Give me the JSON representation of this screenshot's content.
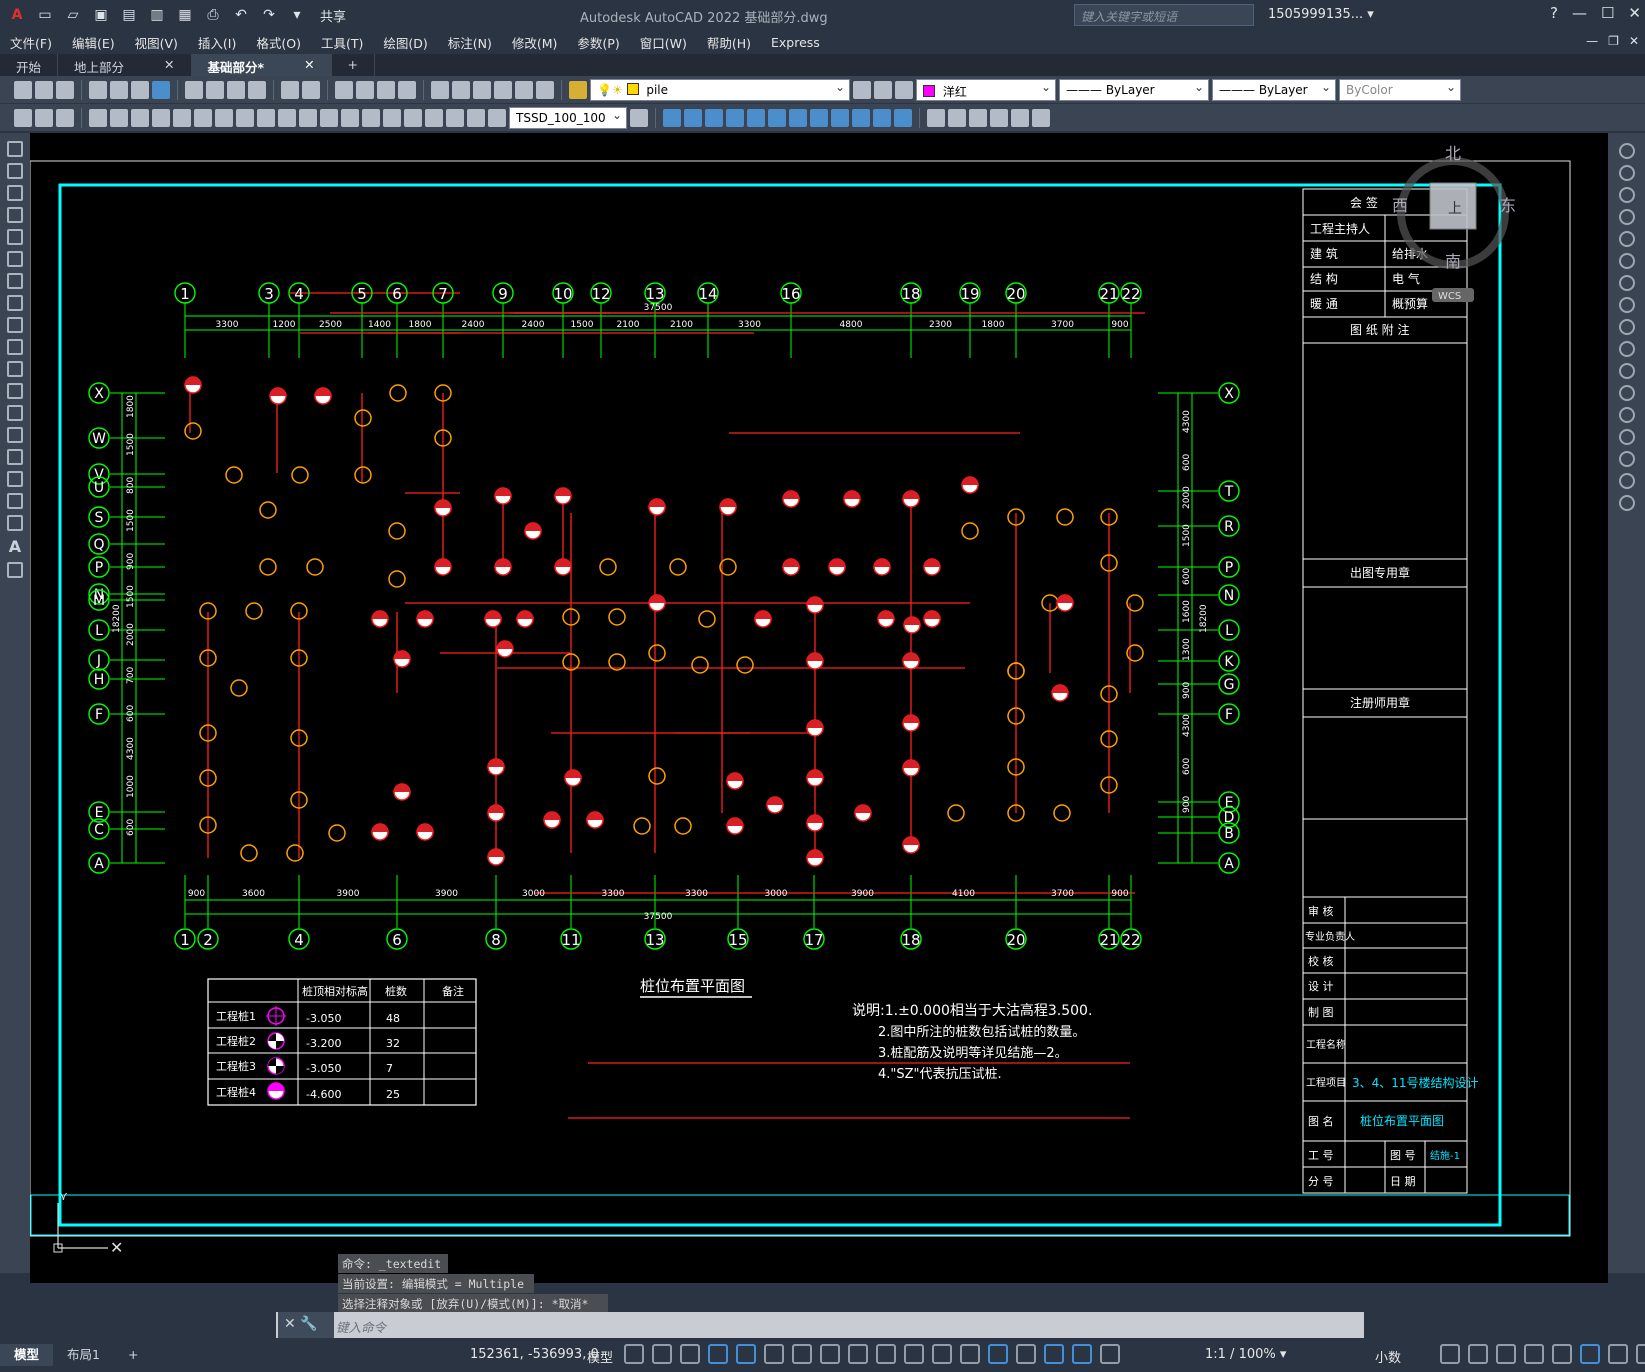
{
  "app": {
    "title": "Autodesk AutoCAD 2022    基础部分.dwg",
    "share_label": "共享",
    "search_placeholder": "键入关键字或短语",
    "user": "1505999135... ▾"
  },
  "menu": [
    "文件(F)",
    "编辑(E)",
    "视图(V)",
    "插入(I)",
    "格式(O)",
    "工具(T)",
    "绘图(D)",
    "标注(N)",
    "修改(M)",
    "参数(P)",
    "窗口(W)",
    "帮助(H)",
    "Express"
  ],
  "tabs": [
    {
      "label": "开始",
      "active": false
    },
    {
      "label": "地上部分",
      "active": false
    },
    {
      "label": "基础部分*",
      "active": true
    }
  ],
  "toolbar": {
    "layer": "pile",
    "color": "洋红",
    "color_hex": "#ff00ff",
    "linetype": "ByLayer",
    "lineweight": "ByLayer",
    "plotstyle": "ByColor",
    "dimstyle": "TSSD_100_100"
  },
  "viewcube": {
    "north": "北",
    "south": "南",
    "east": "东",
    "west": "西",
    "face": "上",
    "wcs": "WCS"
  },
  "drawing": {
    "top_axes": [
      "1",
      "3",
      "4",
      "5",
      "6",
      "7",
      "9",
      "10",
      "12",
      "13",
      "14",
      "16",
      "18",
      "19",
      "20",
      "21",
      "22"
    ],
    "bottom_axes": [
      "1",
      "2",
      "4",
      "6",
      "8",
      "11",
      "13",
      "15",
      "17",
      "18",
      "20",
      "21",
      "22"
    ],
    "left_axes": [
      "X",
      "W",
      "V",
      "U",
      "S",
      "Q",
      "P",
      "N",
      "M",
      "L",
      "J",
      "H",
      "F",
      "E",
      "C",
      "A"
    ],
    "right_axes": [
      "X",
      "T",
      "R",
      "P",
      "N",
      "L",
      "K",
      "G",
      "F",
      "E",
      "D",
      "B",
      "A"
    ],
    "top_dims": [
      "3300",
      "1200",
      "2500",
      "1400",
      "1800",
      "2400",
      "2400",
      "1500",
      "2100",
      "2100",
      "3300",
      "4800",
      "2300",
      "1800",
      "3700",
      "900"
    ],
    "bottom_dims": [
      "900",
      "3600",
      "3900",
      "3900",
      "3000",
      "3300",
      "3300",
      "3000",
      "3900",
      "4100",
      "3700",
      "900"
    ],
    "total_dim": "37500",
    "left_dims": [
      "1800",
      "1500",
      "800",
      "1500",
      "900",
      "1500",
      "2000",
      "700",
      "600",
      "4300",
      "1000",
      "600"
    ],
    "left_total": "18200",
    "right_dims": [
      "4300",
      "600",
      "2000",
      "1500",
      "600",
      "1600",
      "1300",
      "900",
      "4300",
      "600",
      "900"
    ],
    "right_total": "18200",
    "plan_title": "桩位布置平面图",
    "notes": [
      "说明:1.±0.000相当于大沽高程3.500.",
      "2.图中所注的桩数包括试桩的数量。",
      "3.桩配筋及说明等详见结施—2。",
      "4.\"SZ\"代表抗压试桩."
    ],
    "pile_table": {
      "headers": [
        "",
        "桩顶相对标高",
        "桩数",
        "备注"
      ],
      "rows": [
        {
          "name": "工程桩1",
          "elev": "-3.050",
          "count": "48",
          "note": ""
        },
        {
          "name": "工程桩2",
          "elev": "-3.200",
          "count": "32",
          "note": ""
        },
        {
          "name": "工程桩3",
          "elev": "-3.050",
          "count": "7",
          "note": ""
        },
        {
          "name": "工程桩4",
          "elev": "-4.600",
          "count": "25",
          "note": ""
        }
      ]
    },
    "title_block": {
      "hui_qian": "会    签",
      "rows1": [
        [
          "工程主持人",
          ""
        ],
        [
          "建  筑",
          "给排水"
        ],
        [
          "结  构",
          "电  气"
        ],
        [
          "暖  通",
          "概预算"
        ]
      ],
      "tu_zhi_fu_zhu": "图 纸 附 注",
      "chu_tu_zhuan_yong_zhang": "出图专用章",
      "zhu_ce_shi_yong_zhang": "注册师用章",
      "sign_rows": [
        "审  核",
        "专业负责人",
        "校  核",
        "设  计",
        "制  图"
      ],
      "project_name_label": "工程名称",
      "project_item_label": "工程项目",
      "project_item": "3、4、11号楼结构设计",
      "drawing_name_label": "图  名",
      "drawing_name": "桩位布置平面图",
      "job_no_label": "工  号",
      "drawing_no_label": "图  号",
      "drawing_no": "结施-1",
      "sub_no_label": "分  号",
      "date_label": "日  期"
    }
  },
  "command": {
    "lines": [
      "命令: _textedit",
      "当前设置: 编辑模式 = Multiple",
      "选择注释对象或 [放弃(U)/模式(M)]: *取消*"
    ],
    "input_placeholder": "键入命令"
  },
  "status": {
    "layout_tabs": [
      "模型",
      "布局1"
    ],
    "coords": "152361, -536993, 0",
    "model_label": "模型",
    "scale": "1:1 / 100% ▾",
    "units": "小数"
  }
}
